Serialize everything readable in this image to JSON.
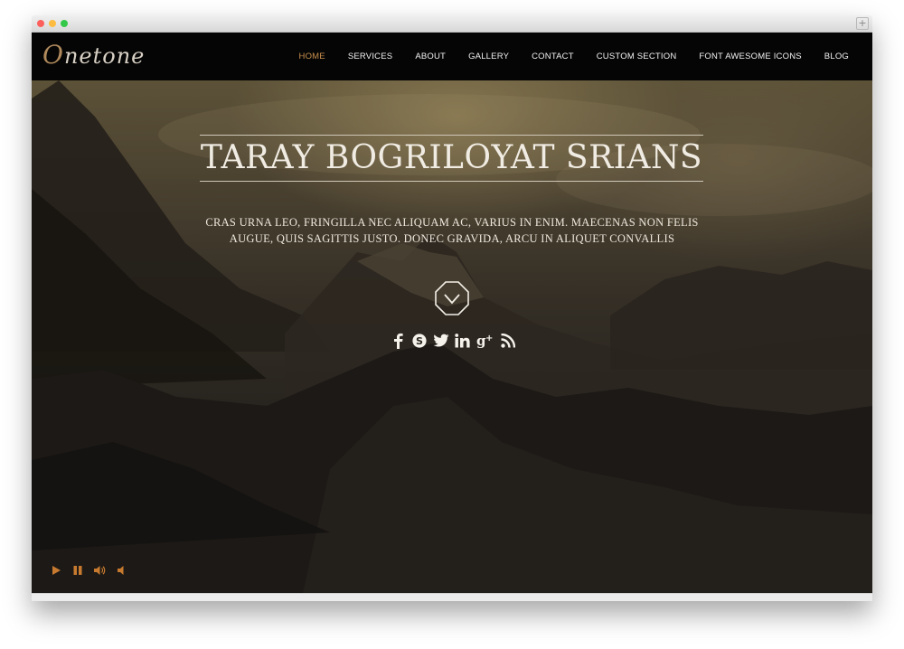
{
  "nav": {
    "logo_first": "O",
    "logo_rest": "netone",
    "items": [
      {
        "label": "HOME",
        "active": true
      },
      {
        "label": "SERVICES"
      },
      {
        "label": "ABOUT"
      },
      {
        "label": "GALLERY"
      },
      {
        "label": "CONTACT"
      },
      {
        "label": "CUSTOM SECTION"
      },
      {
        "label": "FONT AWESOME ICONS"
      },
      {
        "label": "BLOG"
      }
    ]
  },
  "hero": {
    "title": "TARAY BOGRILOYAT SRIANS",
    "subtitle": "CRAS URNA LEO, FRINGILLA NEC ALIQUAM AC, VARIUS IN ENIM. MAECENAS NON FELIS AUGUE, QUIS SAGITTIS JUSTO. DONEC GRAVIDA, ARCU IN ALIQUET CONVALLIS",
    "scroll_icon": "chevron-down-octagon-icon",
    "socials": [
      {
        "icon": "facebook-icon",
        "glyph": "f"
      },
      {
        "icon": "skype-icon",
        "glyph": "S"
      },
      {
        "icon": "twitter-icon",
        "glyph": "t"
      },
      {
        "icon": "linkedin-icon",
        "glyph": "in"
      },
      {
        "icon": "google-plus-icon",
        "glyph": "g+"
      },
      {
        "icon": "rss-icon",
        "glyph": "rss"
      }
    ]
  },
  "video_controls": [
    "play-icon",
    "pause-icon",
    "volume-icon",
    "mute-icon"
  ],
  "colors": {
    "accent": "#c9904e",
    "logo_first": "#b08a5c",
    "nav_bg": "#050505",
    "control_orange": "#c77a2f"
  }
}
